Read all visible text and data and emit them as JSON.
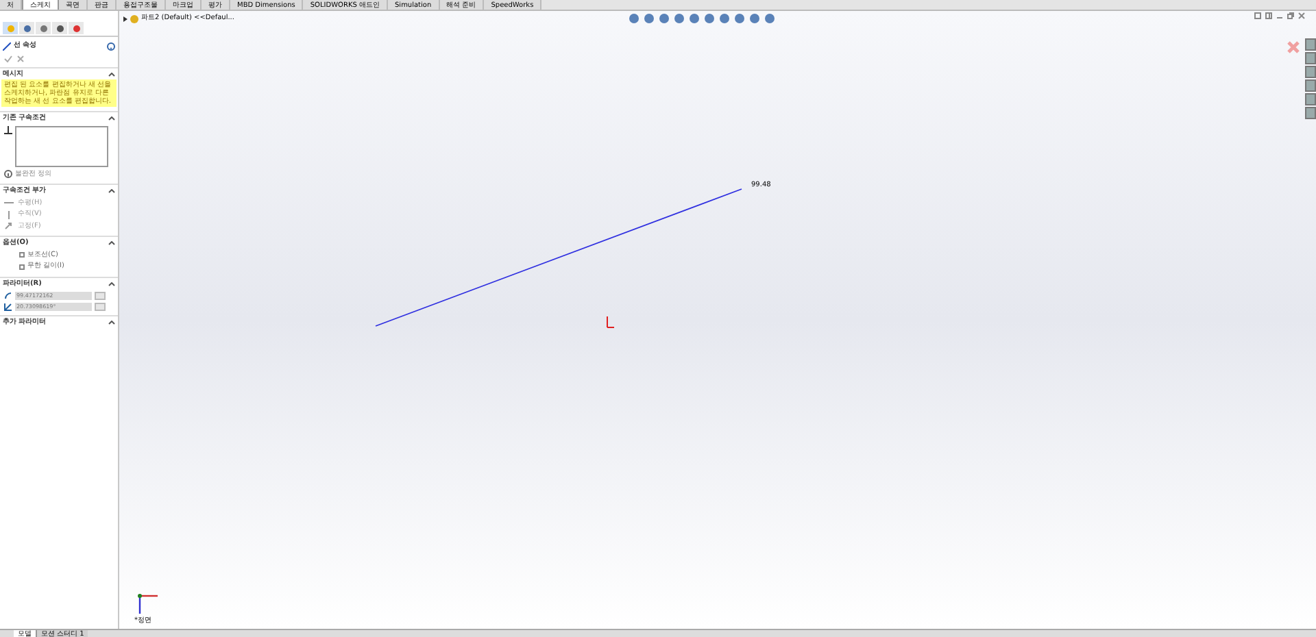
{
  "ribbon_tabs": [
    {
      "label": "처",
      "selected": false
    },
    {
      "label": "스케치",
      "selected": true
    },
    {
      "label": "곡면",
      "selected": false
    },
    {
      "label": "판금",
      "selected": false
    },
    {
      "label": "용접구조물",
      "selected": false
    },
    {
      "label": "마크업",
      "selected": false
    },
    {
      "label": "평가",
      "selected": false
    },
    {
      "label": "MBD Dimensions",
      "selected": false
    },
    {
      "label": "SOLIDWORKS 애드인",
      "selected": false
    },
    {
      "label": "Simulation",
      "selected": false
    },
    {
      "label": "해석 준비",
      "selected": false
    },
    {
      "label": "SpeedWorks",
      "selected": false
    }
  ],
  "breadcrumb": "파트2 (Default) <<Defaul...",
  "manager_tabs": [
    {
      "selected": true
    },
    {
      "selected": false
    },
    {
      "selected": false
    },
    {
      "selected": false
    },
    {
      "selected": false
    }
  ],
  "property_manager": {
    "title": "선 속성",
    "message": {
      "heading": "메시지",
      "text": "편집 된 요소를 편집하거나 새 선을 스케치하거나, 파란점 유지로 다른 작업하는 새 선 요소를 편집합니다."
    },
    "relations": {
      "heading": "기존 구속조건",
      "status": "불완전 정의"
    },
    "add_relations": {
      "heading": "구속조건 부가",
      "items": [
        "수평(H)",
        "수직(V)",
        "고정(F)"
      ]
    },
    "options": {
      "heading": "옵션(O)",
      "items": [
        {
          "label": "보조선(C)",
          "checked": false
        },
        {
          "label": "무한 길이(I)",
          "checked": false
        }
      ]
    },
    "parameters": {
      "heading": "파라미터(R)",
      "values": [
        "99.47172162",
        "20.73098619°"
      ]
    },
    "more": {
      "heading": "추가 파라미터"
    }
  },
  "canvas": {
    "dimension": "99.48",
    "view_label": "*정면"
  },
  "bottom_tabs": [
    {
      "label": "모델",
      "selected": true
    },
    {
      "label": "모션 스터디 1",
      "selected": false
    }
  ]
}
